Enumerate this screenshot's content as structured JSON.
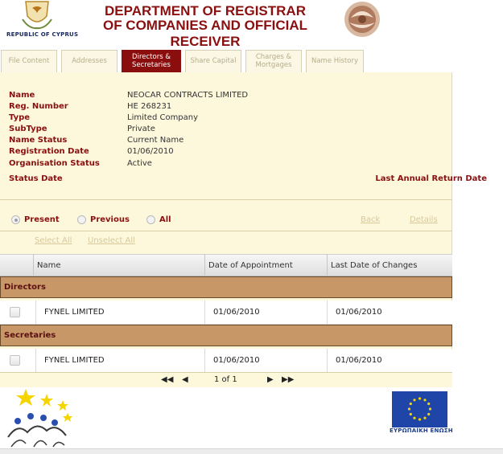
{
  "header": {
    "republic_text": "REPUBLIC OF CYPRUS",
    "title_line1": "DEPARTMENT OF REGISTRAR",
    "title_line2": "OF COMPANIES AND OFFICIAL RECEIVER"
  },
  "tabs": [
    {
      "label_line1": "File Content",
      "label_line2": "",
      "active": false
    },
    {
      "label_line1": "Addresses",
      "label_line2": "",
      "active": false
    },
    {
      "label_line1": "Directors &",
      "label_line2": "Secretaries",
      "active": true
    },
    {
      "label_line1": "Share Capital",
      "label_line2": "",
      "active": false
    },
    {
      "label_line1": "Charges &",
      "label_line2": "Mortgages",
      "active": false
    },
    {
      "label_line1": "Name History",
      "label_line2": "",
      "active": false
    }
  ],
  "company": {
    "name_label": "Name",
    "name": "NEOCAR CONTRACTS LIMITED",
    "reg_label": "Reg. Number",
    "reg": "HE 268231",
    "type_label": "Type",
    "type": "Limited Company",
    "subtype_label": "SubType",
    "subtype": "Private",
    "name_status_label": "Name Status",
    "name_status": "Current Name",
    "reg_date_label": "Registration Date",
    "reg_date": "01/06/2010",
    "org_status_label": "Organisation Status",
    "org_status": "Active",
    "status_date_label": "Status Date",
    "last_annual_label": "Last Annual Return Date"
  },
  "filters": {
    "present": "Present",
    "previous": "Previous",
    "all": "All",
    "selected": "present",
    "back": "Back",
    "details": "Details",
    "select_all": "Select All",
    "unselect_all": "Unselect All"
  },
  "table": {
    "columns": [
      "Name",
      "Date of Appointment",
      "Last Date of Changes"
    ],
    "groups": [
      {
        "title": "Directors",
        "rows": [
          {
            "name": "FYNEL LIMITED",
            "appointed": "01/06/2010",
            "changed": "01/06/2010"
          }
        ]
      },
      {
        "title": "Secretaries",
        "rows": [
          {
            "name": "FYNEL LIMITED",
            "appointed": "01/06/2010",
            "changed": "01/06/2010"
          }
        ]
      }
    ]
  },
  "pager": {
    "first": "◀◀",
    "prev": "◀",
    "page_text": "1 of 1",
    "next": "▶",
    "last": "▶▶"
  },
  "footer": {
    "eu_text": "ΕΥΡΩΠΑΪΚΗ ΕΝΩΣΗ"
  },
  "colors": {
    "brand_red": "#8b0e0e",
    "panel_bg": "#fdf8dc",
    "group_bg": "#c89768",
    "eu_blue": "#1f45a8",
    "star_yellow": "#f5d400"
  }
}
